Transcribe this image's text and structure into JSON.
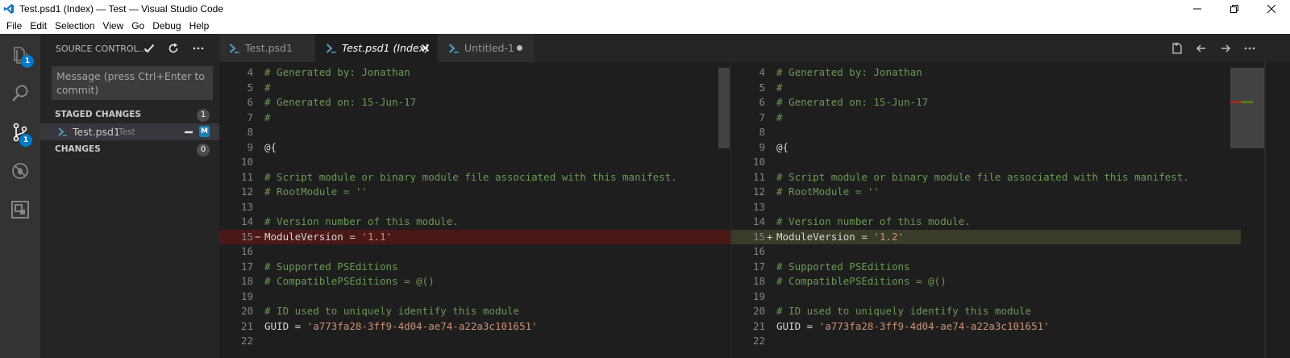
{
  "window": {
    "title": "Test.psd1 (Index) — Test — Visual Studio Code"
  },
  "menu": [
    "File",
    "Edit",
    "Selection",
    "View",
    "Go",
    "Debug",
    "Help"
  ],
  "activity": {
    "explorer_badge": "1",
    "scm_badge": "1"
  },
  "sidebar": {
    "title": "SOURCE CONTROL...",
    "commit_placeholder": "Message (press Ctrl+Enter to commit)",
    "staged": {
      "label": "STAGED CHANGES",
      "count": "1"
    },
    "staged_file": {
      "name": "Test.psd1",
      "folder": "Test",
      "status": "M"
    },
    "changes": {
      "label": "CHANGES",
      "count": "0"
    }
  },
  "tabs": [
    {
      "label": "Test.psd1"
    },
    {
      "label": "Test.psd1 (Index)"
    },
    {
      "label": "Untitled-1"
    }
  ],
  "diff": {
    "left_lines": [
      {
        "n": "4",
        "text": "# Generated by: Jonathan",
        "kind": "comment"
      },
      {
        "n": "5",
        "text": "#",
        "kind": "comment"
      },
      {
        "n": "6",
        "text": "# Generated on: 15-Jun-17",
        "kind": "comment"
      },
      {
        "n": "7",
        "text": "#",
        "kind": "comment"
      },
      {
        "n": "8",
        "text": "",
        "kind": "plain"
      },
      {
        "n": "9",
        "text": "@{",
        "kind": "plain"
      },
      {
        "n": "10",
        "text": "",
        "kind": "plain"
      },
      {
        "n": "11",
        "text": "# Script module or binary module file associated with this manifest.",
        "kind": "comment"
      },
      {
        "n": "12",
        "text": "# RootModule = ''",
        "kind": "comment"
      },
      {
        "n": "13",
        "text": "",
        "kind": "plain"
      },
      {
        "n": "14",
        "text": "# Version number of this module.",
        "kind": "comment"
      },
      {
        "n": "15",
        "text": "ModuleVersion = ",
        "str": "'1.1'",
        "kind": "removed"
      },
      {
        "n": "16",
        "text": "",
        "kind": "plain"
      },
      {
        "n": "17",
        "text": "# Supported PSEditions",
        "kind": "comment"
      },
      {
        "n": "18",
        "text": "# CompatiblePSEditions = @()",
        "kind": "comment"
      },
      {
        "n": "19",
        "text": "",
        "kind": "plain"
      },
      {
        "n": "20",
        "text": "# ID used to uniquely identify this module",
        "kind": "comment"
      },
      {
        "n": "21",
        "text": "GUID = ",
        "str": "'a773fa28-3ff9-4d04-ae74-a22a3c101651'",
        "kind": "plain"
      },
      {
        "n": "22",
        "text": "",
        "kind": "plain"
      }
    ],
    "right_lines": [
      {
        "n": "4",
        "text": "# Generated by: Jonathan",
        "kind": "comment"
      },
      {
        "n": "5",
        "text": "#",
        "kind": "comment"
      },
      {
        "n": "6",
        "text": "# Generated on: 15-Jun-17",
        "kind": "comment"
      },
      {
        "n": "7",
        "text": "#",
        "kind": "comment"
      },
      {
        "n": "8",
        "text": "",
        "kind": "plain"
      },
      {
        "n": "9",
        "text": "@{",
        "kind": "plain"
      },
      {
        "n": "10",
        "text": "",
        "kind": "plain"
      },
      {
        "n": "11",
        "text": "# Script module or binary module file associated with this manifest.",
        "kind": "comment"
      },
      {
        "n": "12",
        "text": "# RootModule = ''",
        "kind": "comment"
      },
      {
        "n": "13",
        "text": "",
        "kind": "plain"
      },
      {
        "n": "14",
        "text": "# Version number of this module.",
        "kind": "comment"
      },
      {
        "n": "15",
        "text": "ModuleVersion = ",
        "str": "'1.2'",
        "kind": "added"
      },
      {
        "n": "16",
        "text": "",
        "kind": "plain"
      },
      {
        "n": "17",
        "text": "# Supported PSEditions",
        "kind": "comment"
      },
      {
        "n": "18",
        "text": "# CompatiblePSEditions = @()",
        "kind": "comment"
      },
      {
        "n": "19",
        "text": "",
        "kind": "plain"
      },
      {
        "n": "20",
        "text": "# ID used to uniquely identify this module",
        "kind": "comment"
      },
      {
        "n": "21",
        "text": "GUID = ",
        "str": "'a773fa28-3ff9-4d04-ae74-a22a3c101651'",
        "kind": "plain"
      },
      {
        "n": "22",
        "text": "",
        "kind": "plain"
      }
    ]
  },
  "colors": {
    "accent": "#007acc",
    "removed_bg": "#4b1818",
    "added_bg": "#373d29",
    "comment": "#6a9955",
    "string": "#ce9178"
  }
}
